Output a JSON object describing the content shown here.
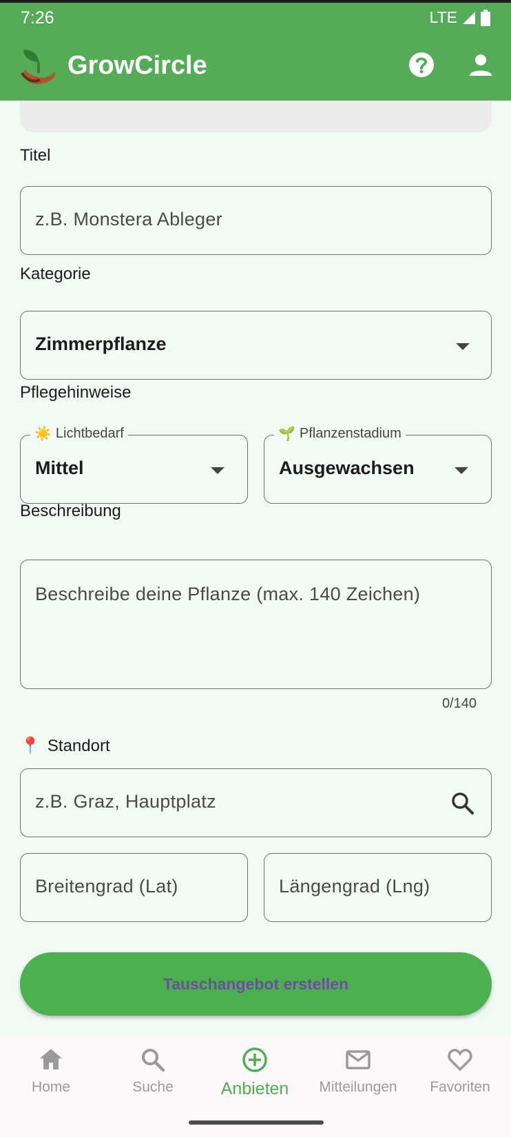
{
  "status_bar": {
    "time": "7:26",
    "network": "LTE"
  },
  "app_bar": {
    "title": "GrowCircle"
  },
  "form": {
    "title_label": "Titel",
    "title_placeholder": "z.B. Monstera Ableger",
    "category_label": "Kategorie",
    "category_value": "Zimmerpflanze",
    "care_label": "Pflegehinweise",
    "light_label_emoji": "☀️",
    "light_label": "Lichtbedarf",
    "light_value": "Mittel",
    "stage_label_emoji": "🌱",
    "stage_label": "Pflanzenstadium",
    "stage_value": "Ausgewachsen",
    "description_label": "Beschreibung",
    "description_placeholder": "Beschreibe deine Pflanze (max. 140 Zeichen)",
    "description_counter": "0/140",
    "location_emoji": "📍",
    "location_label": "Standort",
    "location_placeholder": "z.B. Graz, Hauptplatz",
    "lat_placeholder": "Breitengrad (Lat)",
    "lng_placeholder": "Längengrad (Lng)",
    "submit_label": "Tauschangebot erstellen"
  },
  "bottom_nav": [
    {
      "label": "Home",
      "icon": "home-icon",
      "active": false
    },
    {
      "label": "Suche",
      "icon": "search-icon",
      "active": false
    },
    {
      "label": "Anbieten",
      "icon": "add-circle-icon",
      "active": true
    },
    {
      "label": "Mitteilungen",
      "icon": "mail-icon",
      "active": false
    },
    {
      "label": "Favoriten",
      "icon": "heart-icon",
      "active": false
    }
  ],
  "colors": {
    "primary": "#55ab58",
    "button": "#4caf50",
    "background": "#f1fbf3",
    "button_text": "#6b4ea0"
  }
}
